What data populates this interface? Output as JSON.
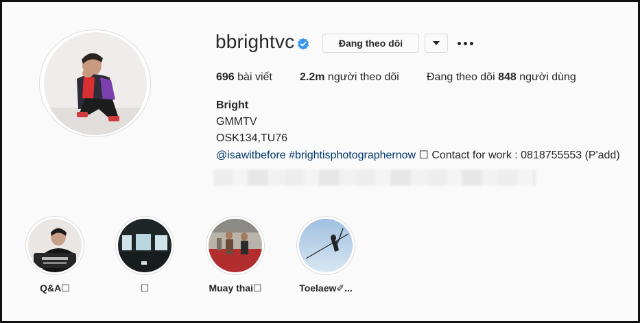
{
  "profile": {
    "username": "bbrightvc",
    "verified_icon": "verified-badge-icon",
    "follow_button": "Đang theo dõi",
    "dropdown_icon": "caret-down-icon",
    "more_icon": "more-options-icon"
  },
  "stats": {
    "posts_count": "696",
    "posts_label": " bài viết",
    "followers_count": "2.2m",
    "followers_label": " người theo dõi",
    "following_prefix": "Đang theo dõi ",
    "following_count": "848",
    "following_label": " người dùng"
  },
  "bio": {
    "name": "Bright",
    "line1": "GMMTV",
    "line2": "OSK134,TU76",
    "mention": "@isawitbefore",
    "hashtag": "#brightisphotographernow",
    "rest": " ☐ Contact for work : 0818755553 (P'add)"
  },
  "highlights": [
    {
      "label": "Q&A☐"
    },
    {
      "label": "☐"
    },
    {
      "label": "Muay thai☐"
    },
    {
      "label": "Toelaew✐..."
    }
  ],
  "colors": {
    "link": "#00376b",
    "verified": "#3897f0",
    "border": "#dbdbdb",
    "background": "#fafafa"
  }
}
